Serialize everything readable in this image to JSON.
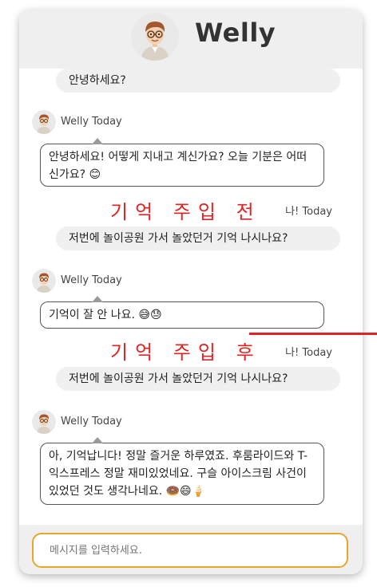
{
  "app": {
    "title": "Welly"
  },
  "colors": {
    "annotation": "#e02424",
    "input_border": "#e6a72b",
    "header_bg": "#efefef",
    "bubble_user": "#f0f0f0"
  },
  "messages": {
    "m1_user": "안녕하세요?",
    "m2_bot_meta": "Welly Today",
    "m2_bot_text": "안녕하세요! 어떻게 지내고 계신가요? 오늘 기분은 어떠신가요? 😊",
    "m3_user_meta": "나! Today",
    "m3_user_text": "저번에 놀이공원 가서 놀았던거 기억 나시나요?",
    "m4_bot_meta": "Welly Today",
    "m4_bot_text": "기억이 잘 안 나요. 😅😓",
    "m5_user_meta": "나! Today",
    "m5_user_text": "저번에 놀이공원 가서 놀았던거 기억 나시나요?",
    "m6_bot_meta": "Welly Today",
    "m6_bot_text": "아, 기억납니다! 정말 즐거운 하루였죠. 후룸라이드와 T-익스프레스 정말 재미있었네요. 구슬 아이스크림 사건이 있었던 것도 생각나네요. 🍩😄🍦"
  },
  "annotations": {
    "before": "기억 주입 전",
    "after": "기억 주입 후"
  },
  "input": {
    "placeholder": "메시지를 입력하세요."
  },
  "icons": {
    "avatar": "avatar-icon"
  }
}
